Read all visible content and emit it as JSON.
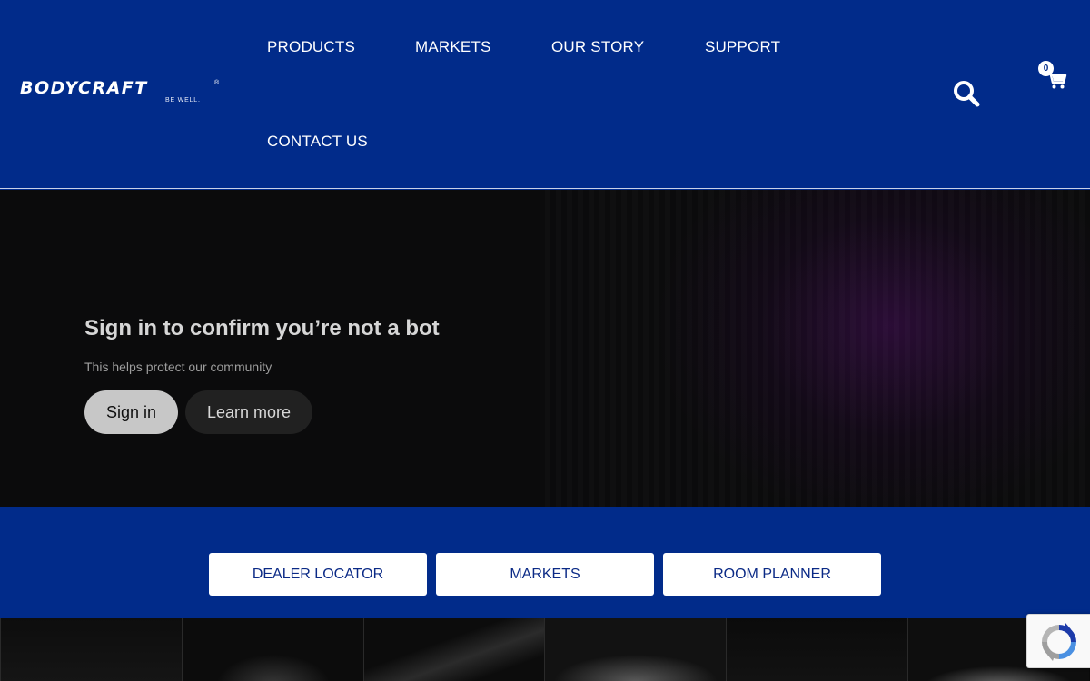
{
  "brand": {
    "name": "BODYCRAFT",
    "tagline": "BE WELL.",
    "registered_mark": "®"
  },
  "nav": {
    "items": [
      {
        "label": "PRODUCTS"
      },
      {
        "label": "MARKETS"
      },
      {
        "label": "OUR STORY"
      },
      {
        "label": "SUPPORT"
      },
      {
        "label": "CONTACT US"
      }
    ]
  },
  "cart": {
    "count": "0"
  },
  "icons": {
    "search": "search-icon",
    "cart": "cart-icon",
    "recaptcha": "recaptcha-icon"
  },
  "hero": {
    "title": "Sign in to confirm you’re not a bot",
    "subtitle": "This helps protect our community",
    "signin_label": "Sign in",
    "learn_more_label": "Learn more"
  },
  "quick_links": [
    {
      "label": "DEALER LOCATOR"
    },
    {
      "label": "MARKETS"
    },
    {
      "label": "ROOM PLANNER"
    }
  ],
  "colors": {
    "brand_blue": "#012b8a",
    "hero_background": "#0b0b0c",
    "button_text": "#0b2a86"
  }
}
